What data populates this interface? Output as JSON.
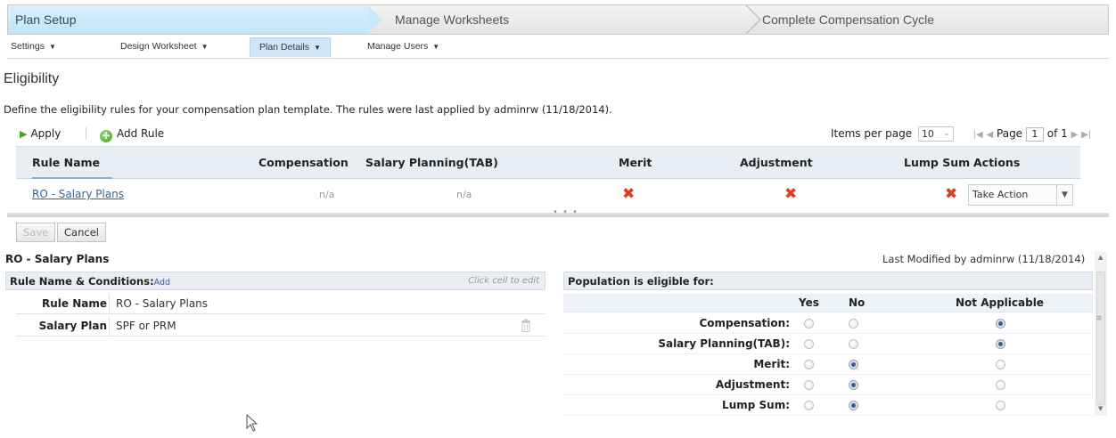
{
  "wizard": {
    "steps": [
      "Plan Setup",
      "Manage Worksheets",
      "Complete Compensation Cycle"
    ]
  },
  "submenu": {
    "items": [
      "Settings",
      "Design Worksheet",
      "Plan Details",
      "Manage Users"
    ],
    "active": "Plan Details"
  },
  "page": {
    "title": "Eligibility",
    "description": "Define the eligibility rules for your compensation plan template. The rules were last applied by adminrw (11/18/2014)."
  },
  "toolbar": {
    "apply_label": "Apply",
    "add_rule_label": "Add Rule"
  },
  "pager": {
    "items_per_page_label": "Items per page",
    "items_per_page": "10",
    "page_label": "Page",
    "current_page": "1",
    "of_label": "of 1"
  },
  "grid": {
    "columns": [
      "Rule Name",
      "Compensation",
      "Salary Planning(TAB)",
      "Merit",
      "Adjustment",
      "Lump Sum",
      "Actions"
    ],
    "rows": [
      {
        "rule_name": "RO - Salary Plans",
        "compensation": "n/a",
        "salary_planning": "n/a",
        "merit": "✖",
        "adjustment": "✖",
        "lump_sum": "✖",
        "action": "Take Action"
      }
    ]
  },
  "detail": {
    "save_label": "Save",
    "cancel_label": "Cancel",
    "title": "RO - Salary Plans",
    "last_modified": "Last Modified by adminrw (11/18/2014)",
    "conditions_header": "Rule Name & Conditions:",
    "add_link": "Add",
    "edit_hint": "Click cell to edit",
    "conditions": [
      {
        "key": "Rule Name",
        "value": "RO - Salary Plans"
      },
      {
        "key": "Salary Plan",
        "value": "SPF or PRM"
      }
    ],
    "eligibility_header": "Population is eligible for:",
    "eligibility_columns": [
      "Yes",
      "No",
      "Not Applicable"
    ],
    "eligibility": [
      {
        "label": "Compensation:",
        "selected": "Not Applicable"
      },
      {
        "label": "Salary Planning(TAB):",
        "selected": "Not Applicable"
      },
      {
        "label": "Merit:",
        "selected": "No"
      },
      {
        "label": "Adjustment:",
        "selected": "No"
      },
      {
        "label": "Lump Sum:",
        "selected": "No"
      }
    ]
  },
  "colors": {
    "active_step": "#c8e9f8",
    "header_bg": "#e9eef4",
    "link": "#2a66a6",
    "x_mark": "#e23b1c",
    "apply_icon": "#4aa32b"
  },
  "icons": [
    "play-icon",
    "add-circle-icon",
    "x-mark-icon",
    "dropdown-arrow-icon",
    "trash-icon",
    "radio-button-icon",
    "mouse-cursor-icon"
  ]
}
